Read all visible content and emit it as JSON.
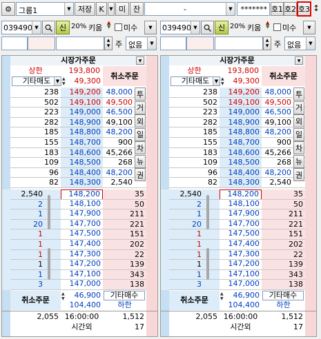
{
  "topbar": {
    "group_value": "그룹1",
    "save_label": "저장",
    "k_label": "K",
    "mi_label": "미",
    "jan_label": "잔",
    "account_value": "-",
    "password_value": "*******",
    "ho1_label": "호1",
    "ho2_label": "호2",
    "ho3_label": "호3",
    "resize_glyph": "↕"
  },
  "colors": {
    "ask_bg": "#dcecf8",
    "bid_bg": "#fbe2e2",
    "side_blue": "#c6dff2",
    "side_pink": "#f7d7d7",
    "current_price_border": "#d00000",
    "header_bg": "#eef3f7"
  },
  "panels": [
    {
      "code": "039490",
      "credit_label": "신",
      "margin_label": "20%",
      "broker_label": "키움",
      "partial_label": "미수",
      "qty_unit_label": "주",
      "none_label": "없음",
      "header": "시장가주문",
      "upper_label": "상한",
      "upper_price": "193,800",
      "other_sell_label": "기타매도",
      "other_sell_value": "49,300",
      "cancel_label": "취소주문",
      "side_buttons": [
        "투",
        "거",
        "외",
        "일",
        "차",
        "뉴",
        "권"
      ],
      "asks": [
        {
          "qty": "238",
          "price": "149,200",
          "right": "48,000"
        },
        {
          "qty": "502",
          "price": "149,100",
          "right": "49,500"
        },
        {
          "qty": "223",
          "price": "149,000",
          "right": "46,500"
        },
        {
          "qty": "282",
          "price": "148,900",
          "right": "49,100"
        },
        {
          "qty": "185",
          "price": "148,800",
          "right": "48,200"
        },
        {
          "qty": "155",
          "price": "148,700",
          "right": "900"
        },
        {
          "qty": "183",
          "price": "148,600",
          "right": "45,266"
        },
        {
          "qty": "109",
          "price": "148,500",
          "right": "268"
        },
        {
          "qty": "96",
          "price": "148,400",
          "right": "48,200"
        },
        {
          "qty": "82",
          "price": "148,300",
          "right": "2,540"
        }
      ],
      "bids": [
        {
          "left": "2,540",
          "price": "148,200",
          "qty": "35"
        },
        {
          "left": "2",
          "price": "148,100",
          "qty": "50"
        },
        {
          "left": "1",
          "price": "147,900",
          "qty": "211"
        },
        {
          "left": "20",
          "price": "147,700",
          "qty": "221"
        },
        {
          "left": "1",
          "price": "147,500",
          "qty": "151"
        },
        {
          "left": "1",
          "price": "147,400",
          "qty": "202"
        },
        {
          "left": "1",
          "price": "147,300",
          "qty": "22"
        },
        {
          "left": "1",
          "price": "147,200",
          "qty": "139"
        },
        {
          "left": "1",
          "price": "147,100",
          "qty": "343"
        },
        {
          "left": "3",
          "price": "147,000",
          "qty": "138"
        }
      ],
      "bid_left_colors": [
        "#000",
        "#0040c0",
        "#0040c0",
        "#0040c0",
        "#d20000",
        "#d20000",
        "#d20000",
        "#000",
        "#0040c0",
        "#0040c0"
      ],
      "bottom_cancel_label": "취소주문",
      "bottom_sum": "46,900",
      "other_buy_label": "기타매수",
      "other_buy_value": "104,400",
      "lower_label": "하한",
      "total_left": "2,055",
      "time": "16:00:00",
      "total_right": "1,512",
      "afterhours_label": "시간외",
      "afterhours_value": "17"
    },
    {
      "code": "039490",
      "credit_label": "신",
      "margin_label": "20%",
      "broker_label": "키움",
      "partial_label": "미수",
      "qty_unit_label": "주",
      "none_label": "없음",
      "header": "시장가주문",
      "upper_label": "상한",
      "upper_price": "193,800",
      "other_sell_label": "기타매도",
      "other_sell_value": "49,300",
      "cancel_label": "취소주문",
      "side_buttons": [
        "투",
        "거",
        "외",
        "일",
        "차",
        "뉴",
        "권"
      ],
      "asks": [
        {
          "qty": "238",
          "price": "149,200",
          "right": "48,000"
        },
        {
          "qty": "502",
          "price": "149,100",
          "right": "49,500"
        },
        {
          "qty": "223",
          "price": "149,000",
          "right": "46,500"
        },
        {
          "qty": "282",
          "price": "148,900",
          "right": "49,100"
        },
        {
          "qty": "185",
          "price": "148,800",
          "right": "48,200"
        },
        {
          "qty": "155",
          "price": "148,700",
          "right": "900"
        },
        {
          "qty": "183",
          "price": "148,600",
          "right": "45,266"
        },
        {
          "qty": "109",
          "price": "148,500",
          "right": "268"
        },
        {
          "qty": "96",
          "price": "148,400",
          "right": "48,200"
        },
        {
          "qty": "82",
          "price": "148,300",
          "right": "2,540"
        }
      ],
      "bids": [
        {
          "left": "2,540",
          "price": "148,200",
          "qty": "35"
        },
        {
          "left": "2",
          "price": "148,100",
          "qty": "50"
        },
        {
          "left": "1",
          "price": "147,900",
          "qty": "211"
        },
        {
          "left": "20",
          "price": "147,700",
          "qty": "221"
        },
        {
          "left": "1",
          "price": "147,500",
          "qty": "151"
        },
        {
          "left": "1",
          "price": "147,400",
          "qty": "202"
        },
        {
          "left": "1",
          "price": "147,300",
          "qty": "22"
        },
        {
          "left": "1",
          "price": "147,200",
          "qty": "139"
        },
        {
          "left": "1",
          "price": "147,100",
          "qty": "343"
        },
        {
          "left": "3",
          "price": "147,000",
          "qty": "138"
        }
      ],
      "bid_left_colors": [
        "#000",
        "#0040c0",
        "#0040c0",
        "#0040c0",
        "#d20000",
        "#d20000",
        "#d20000",
        "#000",
        "#0040c0",
        "#0040c0"
      ],
      "bottom_cancel_label": "취소주문",
      "bottom_sum": "46,900",
      "other_buy_label": "기타매수",
      "other_buy_value": "104,400",
      "lower_label": "하한",
      "total_left": "2,055",
      "time": "16:00:00",
      "total_right": "1,512",
      "afterhours_label": "시간외",
      "afterhours_value": "17"
    }
  ]
}
